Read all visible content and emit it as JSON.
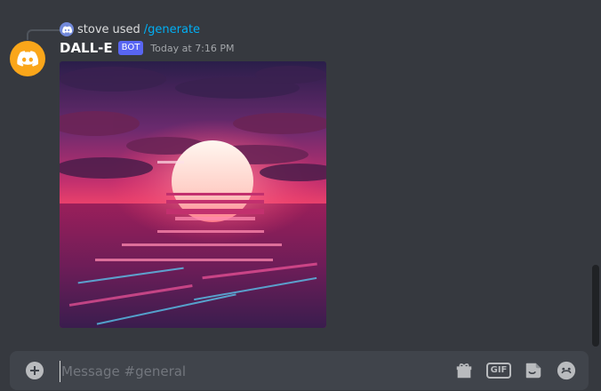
{
  "reply": {
    "user": "stove",
    "verb": "used",
    "command": "/generate"
  },
  "message": {
    "author": "DALL-E",
    "tag": "BOT",
    "timestamp": "Today at 7:16 PM"
  },
  "image": {
    "subject": "synthwave sunset over ocean"
  },
  "composer": {
    "placeholder": "Message #general",
    "gif_label": "GIF"
  },
  "colors": {
    "bot_tag": "#5865f2",
    "avatar": "#faa61a",
    "command_link": "#00aff4"
  },
  "icons": [
    "discord-logo-icon",
    "plus-icon",
    "gift-icon",
    "gif-icon",
    "sticker-icon",
    "emoji-icon"
  ]
}
